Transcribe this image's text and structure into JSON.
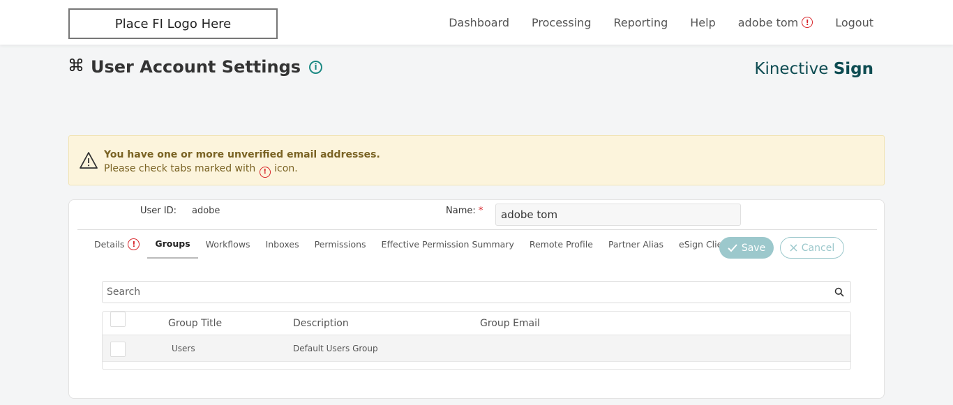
{
  "header": {
    "logo_text": "Place FI Logo Here",
    "nav": {
      "dashboard": "Dashboard",
      "processing": "Processing",
      "reporting": "Reporting",
      "help": "Help",
      "user": "adobe tom",
      "logout": "Logout"
    },
    "alert_glyph": "!"
  },
  "page": {
    "title": "User Account Settings",
    "brand_light": "Kinective",
    "brand_bold": "Sign"
  },
  "warning": {
    "line1": "You have one or more unverified email addresses.",
    "line2_prefix": "Please check tabs marked with",
    "line2_suffix": "icon."
  },
  "form": {
    "user_id_label": "User ID:",
    "user_id_value": "adobe",
    "name_label": "Name:",
    "name_required": "*",
    "name_value": "adobe tom"
  },
  "tabs": [
    {
      "label": "Details",
      "active": false,
      "alert": true
    },
    {
      "label": "Groups",
      "active": true,
      "alert": false
    },
    {
      "label": "Workflows",
      "active": false,
      "alert": false
    },
    {
      "label": "Inboxes",
      "active": false,
      "alert": false
    },
    {
      "label": "Permissions",
      "active": false,
      "alert": false
    },
    {
      "label": "Effective Permission Summary",
      "active": false,
      "alert": false
    },
    {
      "label": "Remote Profile",
      "active": false,
      "alert": false
    },
    {
      "label": "Partner Alias",
      "active": false,
      "alert": false
    },
    {
      "label": "eSign Client",
      "active": false,
      "alert": false
    }
  ],
  "actions": {
    "save": "Save",
    "cancel": "Cancel"
  },
  "search": {
    "placeholder": "Search"
  },
  "table": {
    "columns": [
      "Group Title",
      "Description",
      "Group Email"
    ],
    "rows": [
      {
        "title": "Users",
        "description": "Default Users Group",
        "email": ""
      }
    ]
  },
  "colors": {
    "accent_teal": "#1d8a84",
    "brand_dark": "#0e4c52",
    "alert_red": "#d8262b",
    "warning_bg": "#fcf4dc",
    "button_teal": "#9cc8cc"
  }
}
